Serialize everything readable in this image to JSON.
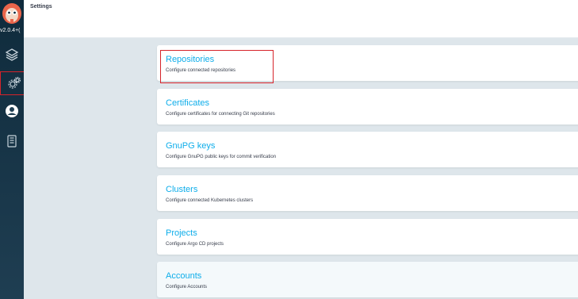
{
  "app": {
    "version": "v2.0.4+(",
    "page_title": "Settings"
  },
  "sidebar": {
    "items": [
      {
        "name": "applications",
        "icon": "layers-icon"
      },
      {
        "name": "settings",
        "icon": "gears-icon",
        "active": true
      },
      {
        "name": "user-info",
        "icon": "user-circle-icon"
      },
      {
        "name": "documentation",
        "icon": "book-icon"
      }
    ]
  },
  "settings": {
    "cards": [
      {
        "title": "Repositories",
        "description": "Configure connected repositories"
      },
      {
        "title": "Certificates",
        "description": "Configure certificates for connecting Git repositories"
      },
      {
        "title": "GnuPG keys",
        "description": "Configure GnuPG public keys for commit verification"
      },
      {
        "title": "Clusters",
        "description": "Configure connected Kubernetes clusters"
      },
      {
        "title": "Projects",
        "description": "Configure Argo CD projects"
      },
      {
        "title": "Accounts",
        "description": "Configure Accounts"
      }
    ]
  },
  "colors": {
    "accent": "#0dadea",
    "highlight": "#d6232a",
    "sidebar": "#0f2b3c",
    "background": "#dee6eb"
  }
}
